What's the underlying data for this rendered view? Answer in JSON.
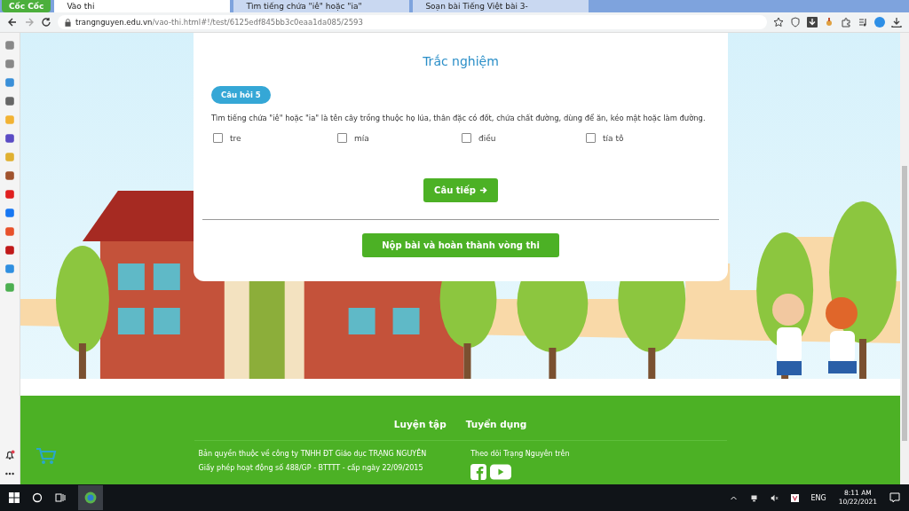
{
  "browser": {
    "logo": "Cốc Cốc",
    "tabs": [
      {
        "title": "Vào thi",
        "selected": true
      },
      {
        "title": "Tìm tiếng chứa \"iê\" hoặc \"ia\"",
        "selected": false
      },
      {
        "title": "Soạn bài Tiếng Việt bài 3-",
        "selected": false
      }
    ],
    "url_host": "trangnguyen.edu.vn",
    "url_path": "/vao-thi.html#!/test/6125edf845bb3c0eaa1da085/2593"
  },
  "quiz": {
    "title": "Trắc nghiệm",
    "question_badge": "Câu hỏi 5",
    "question": "Tìm tiếng chứa \"iê\" hoặc \"ia\" là tên cây trồng thuộc họ lúa, thân đặc có đốt, chứa chất đường, dùng để ăn, kéo mật hoặc làm đường.",
    "options": [
      {
        "label": "tre",
        "checked": false
      },
      {
        "label": "mía",
        "checked": false
      },
      {
        "label": "điều",
        "checked": false
      },
      {
        "label": "tía tô",
        "checked": false
      }
    ],
    "next_button": "Câu tiếp",
    "submit_button": "Nộp bài và hoàn thành vòng thi"
  },
  "footer": {
    "links": [
      "Luyện tập",
      "Tuyển dụng"
    ],
    "copyright": "Bản quyền thuộc về công ty TNHH ĐT Giáo dục TRẠNG NGUYÊN",
    "license": "Giấy phép hoạt động số 488/GP - BTTTT - cấp ngày 22/09/2015",
    "follow": "Theo dõi Trạng Nguyên trên"
  },
  "taskbar": {
    "language": "ENG",
    "time": "8:11 AM",
    "date": "10/22/2021"
  }
}
